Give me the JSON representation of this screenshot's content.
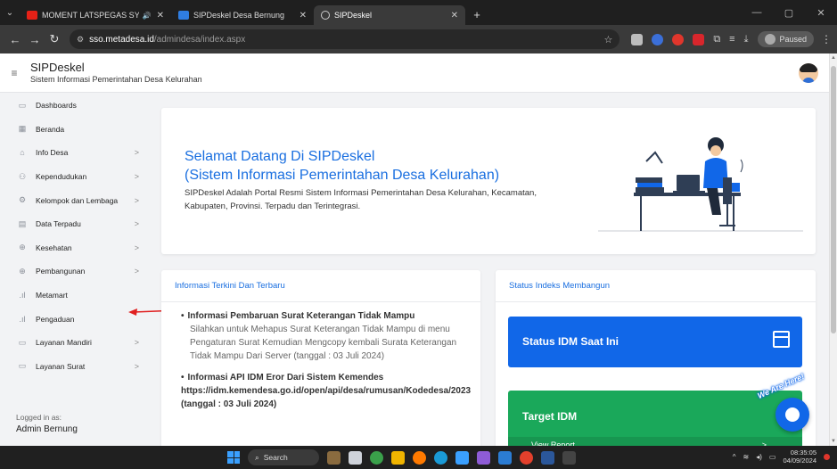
{
  "browser": {
    "tabs": [
      {
        "label": "MOMENT LATSPEGAS SYIL",
        "icon": "youtube-icon",
        "audio": "🔊"
      },
      {
        "label": "SIPDeskel Desa Bernung",
        "icon": "site-favicon"
      },
      {
        "label": "SIPDeskel",
        "icon": "loading-icon"
      }
    ],
    "new_tab": "+",
    "address_host": "sso.metadesa.id",
    "address_path": "/admindesa/index.aspx",
    "profile_status": "Paused"
  },
  "app": {
    "title": "SIPDeskel",
    "subtitle": "Sistem Informasi Pemerintahan Desa Kelurahan"
  },
  "sidebar": {
    "items": [
      {
        "label": "Dashboards",
        "icon": "monitor-icon",
        "chevron": ""
      },
      {
        "label": "Beranda",
        "icon": "grid-icon",
        "chevron": ""
      },
      {
        "label": "Info Desa",
        "icon": "building-icon",
        "chevron": ">"
      },
      {
        "label": "Kependudukan",
        "icon": "users-icon",
        "chevron": ">"
      },
      {
        "label": "Kelompok dan Lembaga",
        "icon": "group-icon",
        "chevron": ">"
      },
      {
        "label": "Data Terpadu",
        "icon": "data-icon",
        "chevron": ">"
      },
      {
        "label": "Kesehatan",
        "icon": "globe-icon",
        "chevron": ">"
      },
      {
        "label": "Pembangunan",
        "icon": "globe-icon",
        "chevron": ">"
      },
      {
        "label": "Metamart",
        "icon": "bar-chart-icon",
        "chevron": ""
      },
      {
        "label": "Pengaduan",
        "icon": "bar-chart-icon",
        "chevron": ""
      },
      {
        "label": "Layanan Mandiri",
        "icon": "document-icon",
        "chevron": ">"
      },
      {
        "label": "Layanan Surat",
        "icon": "document-icon",
        "chevron": ">"
      }
    ],
    "logged_in_label": "Logged in as:",
    "logged_in_user": "Admin Bernung"
  },
  "welcome": {
    "title_line1": "Selamat Datang Di SIPDeskel",
    "title_line2": "(Sistem Informasi Pemerintahan Desa Kelurahan)",
    "description": "SIPDeskel Adalah Portal Resmi Sistem Informasi Pemerintahan Desa Kelurahan, Kecamatan, Kabupaten, Provinsi. Terpadu dan Terintegrasi."
  },
  "info": {
    "heading": "Informasi Terkini Dan Terbaru",
    "items": [
      {
        "title": "Informasi Pembaruan Surat Keterangan Tidak Mampu",
        "body": "Silahkan untuk Mehapus Surat Keterangan Tidak Mampu di menu Pengaturan Surat Kemudian Mengcopy kembali Surata Keterangan Tidak Mampu Dari Server (tanggal : 03 Juli 2024)"
      },
      {
        "title": "Informasi API IDM Eror Dari Sistem Kemendes https://idm.kemendesa.go.id/open/api/desa/rumusan/Kodedesa/2023 (tanggal : 03 Juli 2024)",
        "body": ""
      }
    ]
  },
  "status": {
    "heading": "Status Indeks Membangun",
    "idm_now": "Status IDM Saat Ini",
    "idm_target": "Target IDM",
    "view_report": "View Report",
    "view_report_arrow": ">"
  },
  "chat": {
    "label": "We Are Here!"
  },
  "taskbar": {
    "search": "Search",
    "time": "08:35:05",
    "date": "04/09/2024"
  },
  "colors": {
    "accent": "#1a6fe0",
    "idm_blue": "#1167e8",
    "idm_green": "#1aa85a",
    "annotation_red": "#e02020"
  }
}
